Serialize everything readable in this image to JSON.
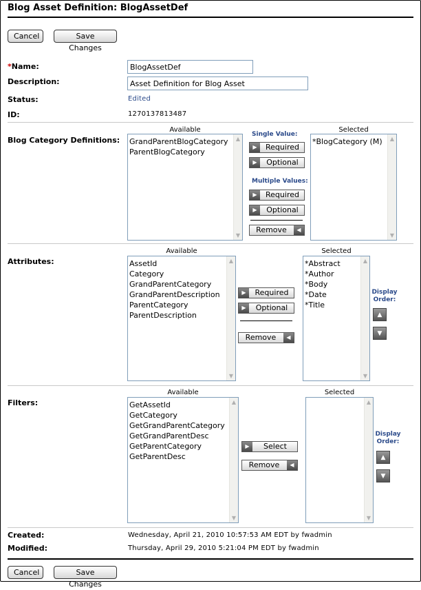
{
  "page": {
    "title": "Blog Asset Definition: BlogAssetDef",
    "buttons": {
      "cancel": "Cancel",
      "save": "Save Changes"
    }
  },
  "form": {
    "name_required_mark": "*",
    "name_label": "Name:",
    "name_value": "BlogAssetDef",
    "description_label": "Description:",
    "description_value": "Asset Definition for Blog Asset",
    "status_label": "Status:",
    "status_value": "Edited",
    "id_label": "ID:",
    "id_value": "1270137813487"
  },
  "category_defs": {
    "label": "Blog Category Definitions:",
    "available_caption": "Available",
    "selected_caption": "Selected",
    "available": [
      "GrandParentBlogCategory",
      "ParentBlogCategory"
    ],
    "selected": [
      "*BlogCategory (M)"
    ],
    "single_value_label": "Single Value:",
    "multiple_values_label": "Multiple Values:",
    "required_label": "Required",
    "optional_label": "Optional",
    "remove_label": "Remove"
  },
  "attributes": {
    "label": "Attributes:",
    "available_caption": "Available",
    "selected_caption": "Selected",
    "available": [
      "AssetId",
      "Category",
      "GrandParentCategory",
      "GrandParentDescription",
      "ParentCategory",
      "ParentDescription"
    ],
    "selected": [
      "*Abstract",
      "*Author",
      "*Body",
      "*Date",
      "*Title"
    ],
    "required_label": "Required",
    "optional_label": "Optional",
    "remove_label": "Remove",
    "display_order_label": "Display Order:"
  },
  "filters": {
    "label": "Filters:",
    "available_caption": "Available",
    "selected_caption": "Selected",
    "available": [
      "GetAssetId",
      "GetCategory",
      "GetGrandParentCategory",
      "GetGrandParentDesc",
      "GetParentCategory",
      "GetParentDesc"
    ],
    "selected": [],
    "select_label": "Select",
    "remove_label": "Remove",
    "display_order_label": "Display Order:"
  },
  "footer": {
    "created_label": "Created:",
    "created_value": "Wednesday, April 21, 2010 10:57:53 AM EDT by fwadmin",
    "modified_label": "Modified:",
    "modified_value": "Thursday, April 29, 2010 5:21:04 PM EDT by fwadmin"
  },
  "icons": {
    "arrow_right": "right-arrow-icon",
    "arrow_left": "left-arrow-icon",
    "arrow_up": "up-arrow-icon",
    "arrow_down": "down-arrow-icon"
  },
  "colors": {
    "required_mark": "#cc0000",
    "link_blue": "#2b4a8a",
    "listbox_border": "#7f9db9"
  }
}
